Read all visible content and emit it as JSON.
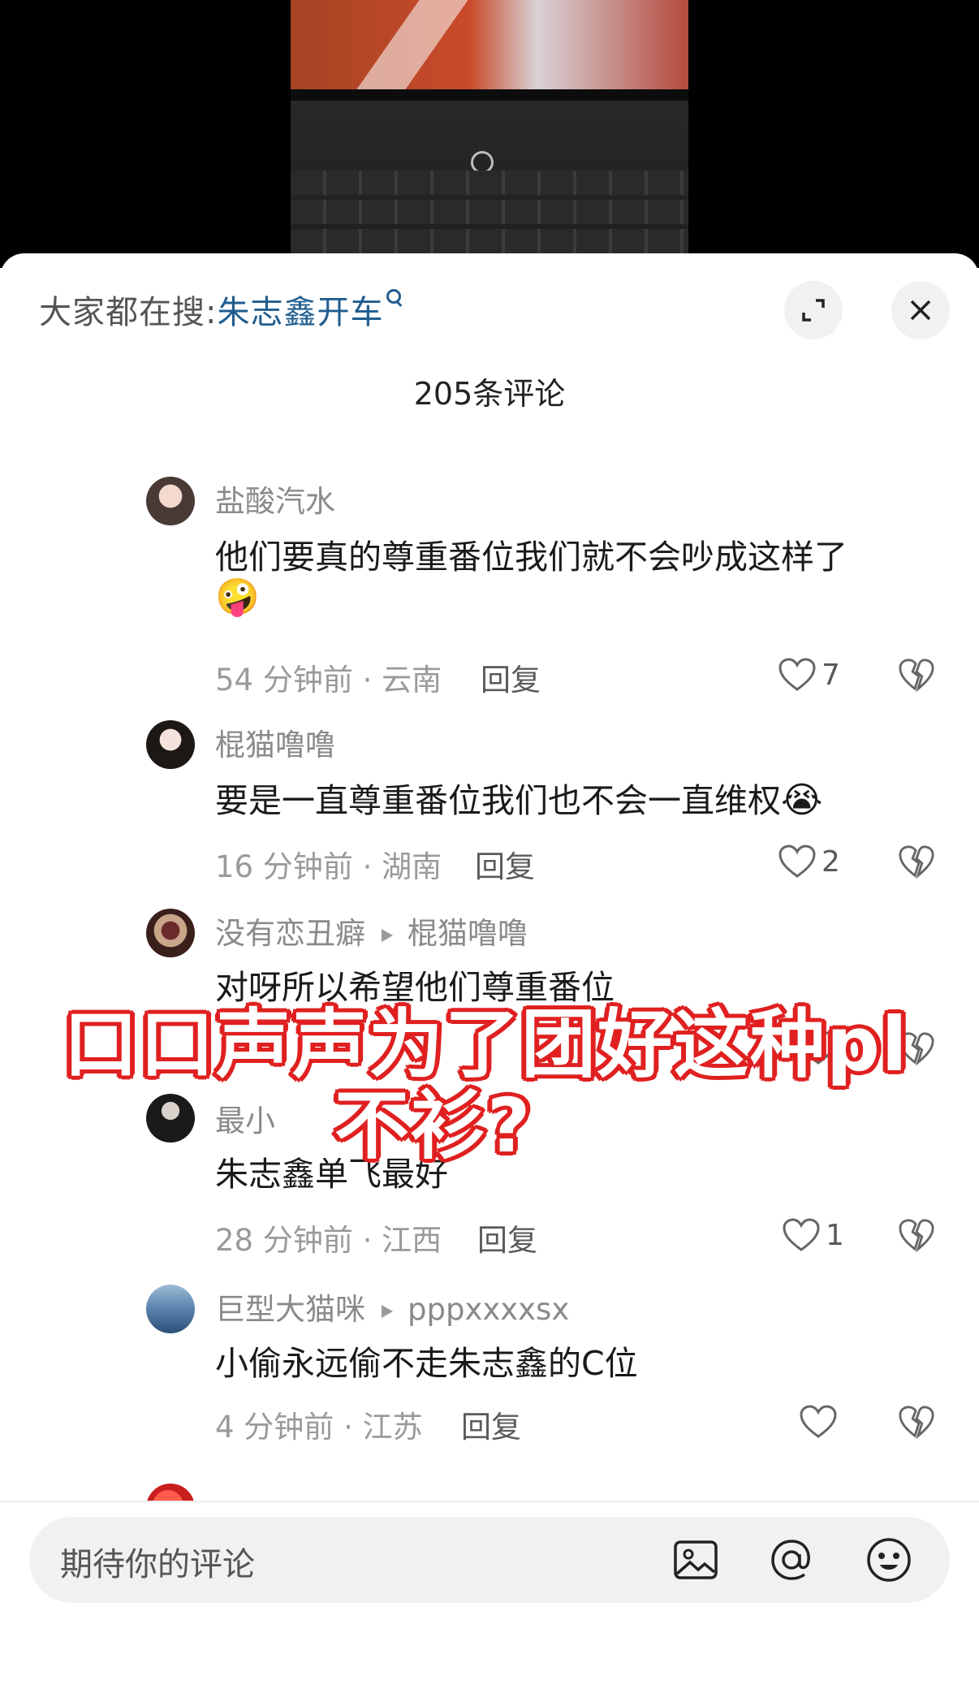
{
  "header": {
    "search_prefix": "大家都在搜:",
    "search_keyword": "朱志鑫开车",
    "comment_count_title": "205条评论"
  },
  "comments": [
    {
      "username": "盐酸汽水",
      "text_line1": "他们要真的尊重番位我们就不会吵成这样了",
      "emoji": "🤪",
      "time_location": "54 分钟前 · 云南",
      "reply_label": "回复",
      "likes": "7"
    },
    {
      "username": "棍猫噜噜",
      "text_line1": "要是一直尊重番位我们也不会一直维权",
      "emoji": "😭",
      "time_location": "16 分钟前 · 湖南",
      "reply_label": "回复",
      "likes": "2"
    },
    {
      "username": "没有恋丑癖",
      "reply_to": "棍猫噜噜",
      "text_line1": "对呀所以希望他们尊重番位",
      "likes": ""
    },
    {
      "username": "最小",
      "text_line1": "朱志鑫单飞最好",
      "time_location": "28 分钟前 · 江西",
      "reply_label": "回复",
      "likes": "1"
    },
    {
      "username": "巨型大猫咪",
      "reply_to": "pppxxxxsx",
      "text_line1": "小偷永远偷不走朱志鑫的C位",
      "time_location": "4 分钟前 · 江苏",
      "reply_label": "回复",
      "likes": ""
    }
  ],
  "overlay": {
    "line1": "口口声声为了团好这种pl",
    "line2": "不衫?"
  },
  "input": {
    "placeholder": "期待你的评论"
  },
  "colors": {
    "keyword_blue": "#215d8f",
    "overlay_red": "#e02020"
  },
  "icons": [
    "expand-icon",
    "close-icon",
    "heart-icon",
    "broken-heart-icon",
    "image-icon",
    "at-icon",
    "smiley-icon"
  ]
}
